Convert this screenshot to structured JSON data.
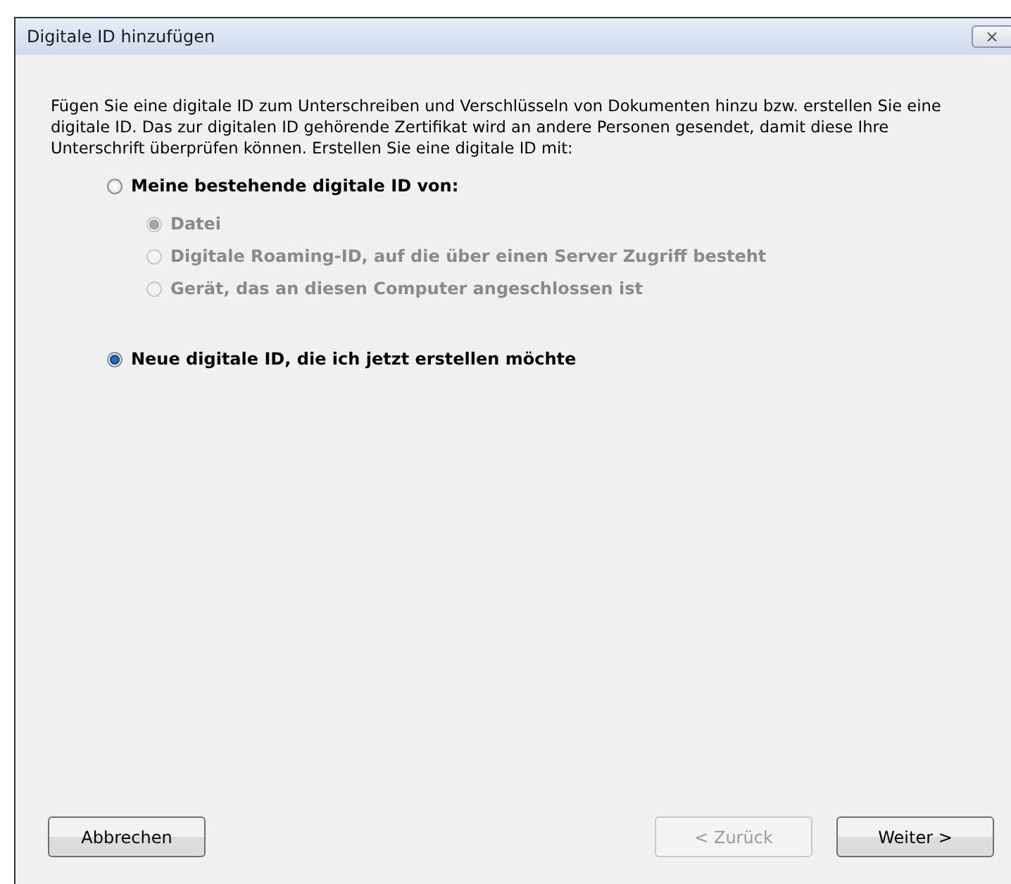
{
  "window": {
    "title": "Digitale ID hinzufügen",
    "close": "⨯"
  },
  "intro": "Fügen Sie eine digitale ID zum Unterschreiben und Verschlüsseln von Dokumenten hinzu bzw. erstellen Sie eine digitale ID. Das zur digitalen ID gehörende Zertifikat wird an andere Personen gesendet, damit diese Ihre Unterschrift überprüfen können. Erstellen Sie eine digitale ID mit:",
  "options": [
    {
      "label": "Meine bestehende digitale ID von:",
      "selected": false,
      "disabled": false,
      "children": [
        {
          "label": "Datei",
          "selected": true,
          "disabled": true
        },
        {
          "label": "Digitale Roaming-ID, auf die über einen Server Zugriff besteht",
          "selected": false,
          "disabled": true
        },
        {
          "label": "Gerät, das an diesen Computer angeschlossen ist",
          "selected": false,
          "disabled": true
        }
      ]
    },
    {
      "label": "Neue digitale ID, die ich jetzt erstellen möchte",
      "selected": true,
      "disabled": false
    }
  ],
  "buttons": [
    {
      "label": "Abbrechen",
      "disabled": false
    },
    {
      "label": "< Zurück",
      "disabled": true
    },
    {
      "label": "Weiter >",
      "disabled": false
    }
  ]
}
